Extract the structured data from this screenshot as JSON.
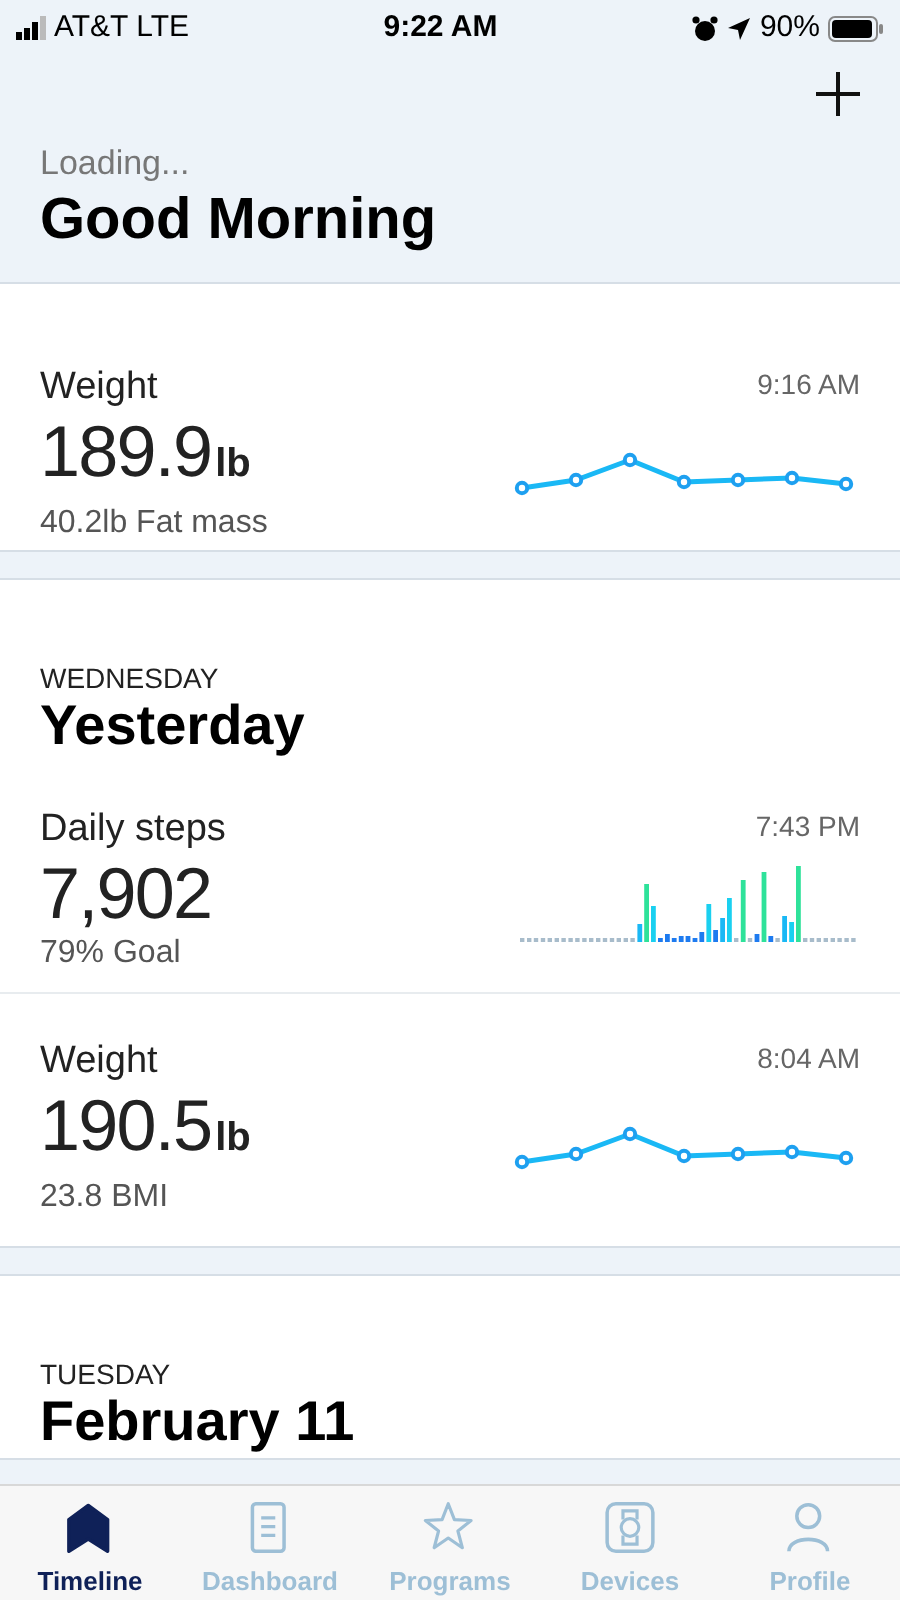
{
  "status_bar": {
    "carrier": "AT&T LTE",
    "time": "9:22 AM",
    "battery": "90%"
  },
  "header": {
    "subtitle": "Loading...",
    "title": "Good Morning"
  },
  "sections": [
    {
      "entries": [
        {
          "kind": "weight",
          "title": "Weight",
          "time": "9:16 AM",
          "value": "189.9",
          "unit": "lb",
          "detail": "40.2lb Fat mass"
        }
      ]
    },
    {
      "day": "WEDNESDAY",
      "date": "Yesterday",
      "entries": [
        {
          "kind": "steps",
          "title": "Daily steps",
          "time": "7:43 PM",
          "value": "7,902",
          "detail": "79% Goal"
        },
        {
          "kind": "weight",
          "title": "Weight",
          "time": "8:04 AM",
          "value": "190.5",
          "unit": "lb",
          "detail": "23.8 BMI"
        }
      ]
    },
    {
      "day": "TUESDAY",
      "date": "February 11"
    }
  ],
  "tabs": [
    {
      "label": "Timeline",
      "selected": true
    },
    {
      "label": "Dashboard",
      "selected": false
    },
    {
      "label": "Programs",
      "selected": false
    },
    {
      "label": "Devices",
      "selected": false
    },
    {
      "label": "Profile",
      "selected": false
    }
  ]
}
